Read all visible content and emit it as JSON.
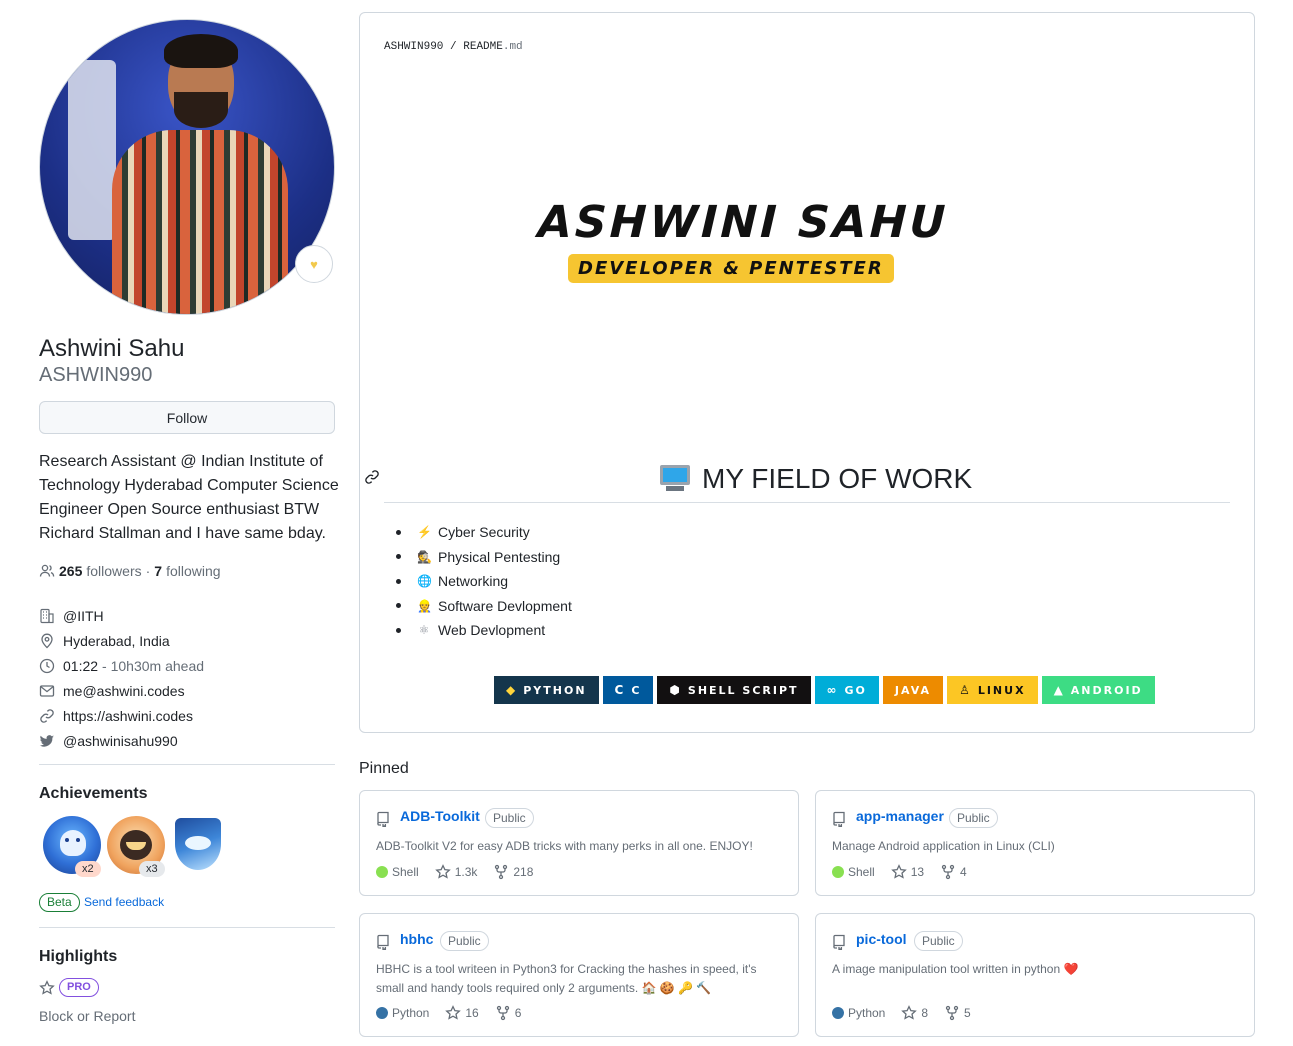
{
  "profile": {
    "name": "Ashwini Sahu",
    "login": "ASHWIN990",
    "follow_label": "Follow",
    "bio": "Research Assistant @ Indian Institute of Technology Hyderabad Computer Science Engineer Open Source enthusiast BTW Richard Stallman and I have same bday.",
    "followers_count": "265",
    "followers_label": "followers",
    "separator": "·",
    "following_count": "7",
    "following_label": "following",
    "org": "@IITH",
    "location": "Hyderabad, India",
    "time": "01:22",
    "time_offset": "- 10h30m ahead",
    "email": "me@ashwini.codes",
    "website": "https://ashwini.codes",
    "twitter": "@ashwinisahu990"
  },
  "achievements": {
    "title": "Achievements",
    "items": [
      {
        "icon": "shark-badge-icon",
        "count": "x2"
      },
      {
        "icon": "cat-badge-icon",
        "count": "x3"
      },
      {
        "icon": "arctic-badge-icon",
        "count": ""
      }
    ],
    "beta_label": "Beta",
    "feedback_label": "Send feedback"
  },
  "highlights": {
    "title": "Highlights",
    "pro_label": "PRO",
    "block_label": "Block or Report"
  },
  "readme": {
    "crumb_user": "ASHWIN990",
    "crumb_sep": "/",
    "crumb_file": "README",
    "crumb_ext": ".md",
    "hero_name": "ASHWINI SAHU",
    "hero_sub": "DEVELOPER & PENTESTER",
    "field_title": "MY FIELD OF WORK",
    "fields": [
      {
        "emoji": "⚡",
        "label": "Cyber Security"
      },
      {
        "emoji": "🕵",
        "label": "Physical Pentesting"
      },
      {
        "emoji": "🌐",
        "label": "Networking"
      },
      {
        "emoji": "👷",
        "label": "Software Devlopment"
      },
      {
        "emoji": "⚛",
        "label": "Web Devlopment"
      }
    ],
    "badges": [
      {
        "label": "PYTHON",
        "icon": "python-icon",
        "color": "#14354c"
      },
      {
        "label": "C",
        "icon": "c-icon",
        "color": "#00599c"
      },
      {
        "label": "SHELL SCRIPT",
        "icon": "shell-icon",
        "color": "#121011"
      },
      {
        "label": "GO",
        "icon": "go-icon",
        "color": "#00add8"
      },
      {
        "label": "JAVA",
        "icon": "java-icon",
        "color": "#ed8b00"
      },
      {
        "label": "LINUX",
        "icon": "linux-icon",
        "color": "#fcc624"
      },
      {
        "label": "ANDROID",
        "icon": "android-icon",
        "color": "#3ddc84"
      }
    ]
  },
  "pinned": {
    "title": "Pinned",
    "repos": [
      {
        "name": "ADB-Toolkit",
        "visibility": "Public",
        "description": "ADB-Toolkit V2 for easy ADB tricks with many perks in all one. ENJOY!",
        "language": "Shell",
        "lang_color": "#89e051",
        "stars": "1.3k",
        "forks": "218"
      },
      {
        "name": "app-manager",
        "visibility": "Public",
        "description": "Manage Android application in Linux (CLI)",
        "language": "Shell",
        "lang_color": "#89e051",
        "stars": "13",
        "forks": "4"
      },
      {
        "name": "hbhc",
        "visibility": "Public",
        "description": "HBHC is a tool writeen in Python3 for Cracking the hashes in speed, it's small and handy tools required only 2 arguments. 🏠 🍪 🔑 🔨",
        "language": "Python",
        "lang_color": "#3572a5",
        "stars": "16",
        "forks": "6"
      },
      {
        "name": "pic-tool",
        "visibility": "Public",
        "description": "A image manipulation tool written in python ❤️",
        "language": "Python",
        "lang_color": "#3572a5",
        "stars": "8",
        "forks": "5"
      }
    ]
  }
}
